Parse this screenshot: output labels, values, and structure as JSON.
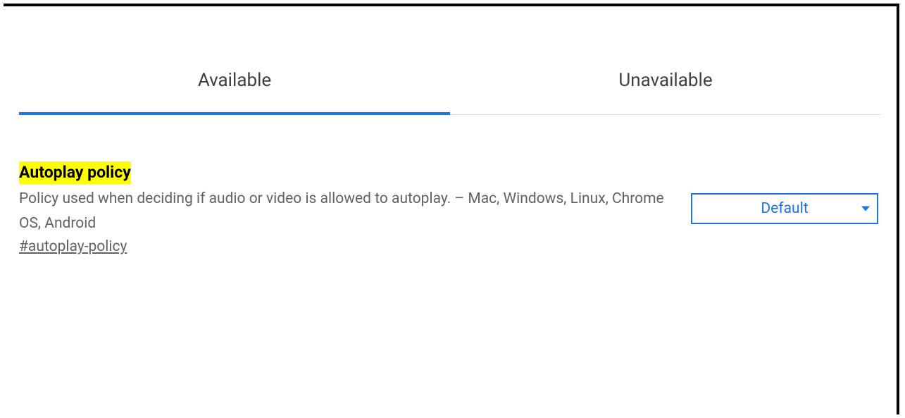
{
  "tabs": {
    "available": "Available",
    "unavailable": "Unavailable"
  },
  "flag": {
    "title": "Autoplay policy",
    "description": "Policy used when deciding if audio or video is allowed to autoplay. – Mac, Windows, Linux, Chrome OS, Android",
    "anchor": "#autoplay-policy",
    "selected_option": "Default"
  },
  "colors": {
    "accent": "#1a73e8",
    "highlight": "#feff00",
    "text_secondary": "#5f6368"
  }
}
